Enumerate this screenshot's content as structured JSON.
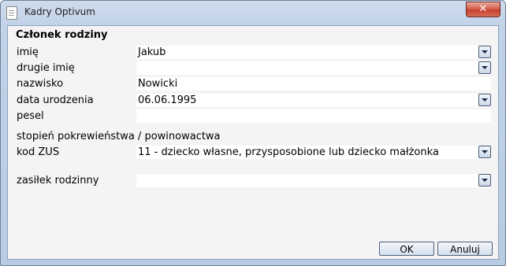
{
  "window": {
    "title": "Kadry Optivum"
  },
  "form": {
    "group_title": "Członek rodziny",
    "fields": [
      {
        "label": "imię",
        "value": "Jakub",
        "has_dropdown": true
      },
      {
        "label": "drugie imię",
        "value": "",
        "has_dropdown": true
      },
      {
        "label": "nazwisko",
        "value": "Nowicki",
        "has_dropdown": false
      },
      {
        "label": "data urodzenia",
        "value": "06.06.1995",
        "has_dropdown": true
      },
      {
        "label": "pesel",
        "value": "",
        "has_dropdown": false
      }
    ],
    "relationship_section_label": "stopień pokrewieństwa / powinowactwa",
    "kod_zus": {
      "label": "kod ZUS",
      "value": "11 - dziecko własne, przysposobione lub dziecko małżonka"
    },
    "zasilek": {
      "label": "zasiłek rodzinny",
      "value": ""
    }
  },
  "buttons": {
    "ok_label": "OK",
    "cancel_label": "Anuluj"
  }
}
